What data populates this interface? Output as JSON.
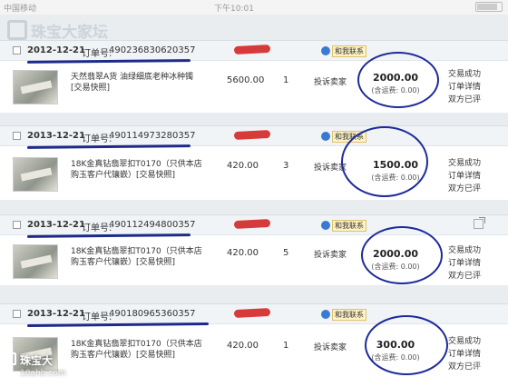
{
  "status_bar": {
    "carrier": "中国移动",
    "time": "下午10:01"
  },
  "watermark": {
    "top_text": "珠宝大家坛",
    "bottom_name": "珠宝大",
    "bottom_url": "18ahb.com"
  },
  "common": {
    "order_no_label": "订单号:",
    "contact_label": "和我联系",
    "complaint": "投诉卖家",
    "status_success": "交易成功",
    "order_details": "订单详情",
    "rated": "双方已评"
  },
  "orders": [
    {
      "date": "2012-12-21",
      "order_no": "490236830620357",
      "title": "天然翡翠A货 油绿细底老种冰种镯 [交易快照]",
      "price": "5600.00",
      "qty": "1",
      "total": "2000.00",
      "shipping": "(含运费: 0.00)"
    },
    {
      "date": "2013-12-21",
      "order_no": "490114973280357",
      "title": "18K金真钻翡翠扣T0170（只供本店购玉客户代镶嵌）[交易快照]",
      "price": "420.00",
      "qty": "3",
      "total": "1500.00",
      "shipping": "(含运费: 0.00)"
    },
    {
      "date": "2013-12-21",
      "order_no": "490112494800357",
      "title": "18K金真钻翡翠扣T0170（只供本店购玉客户代镶嵌）[交易快照]",
      "price": "420.00",
      "qty": "5",
      "total": "2000.00",
      "shipping": "(含运费: 0.00)"
    },
    {
      "date": "2013-12-21",
      "order_no": "490180965360357",
      "title": "18K金真钻翡翠扣T0170（只供本店购玉客户代镶嵌）[交易快照]",
      "price": "420.00",
      "qty": "1",
      "total": "300.00",
      "shipping": "(含运费: 0.00)"
    }
  ]
}
